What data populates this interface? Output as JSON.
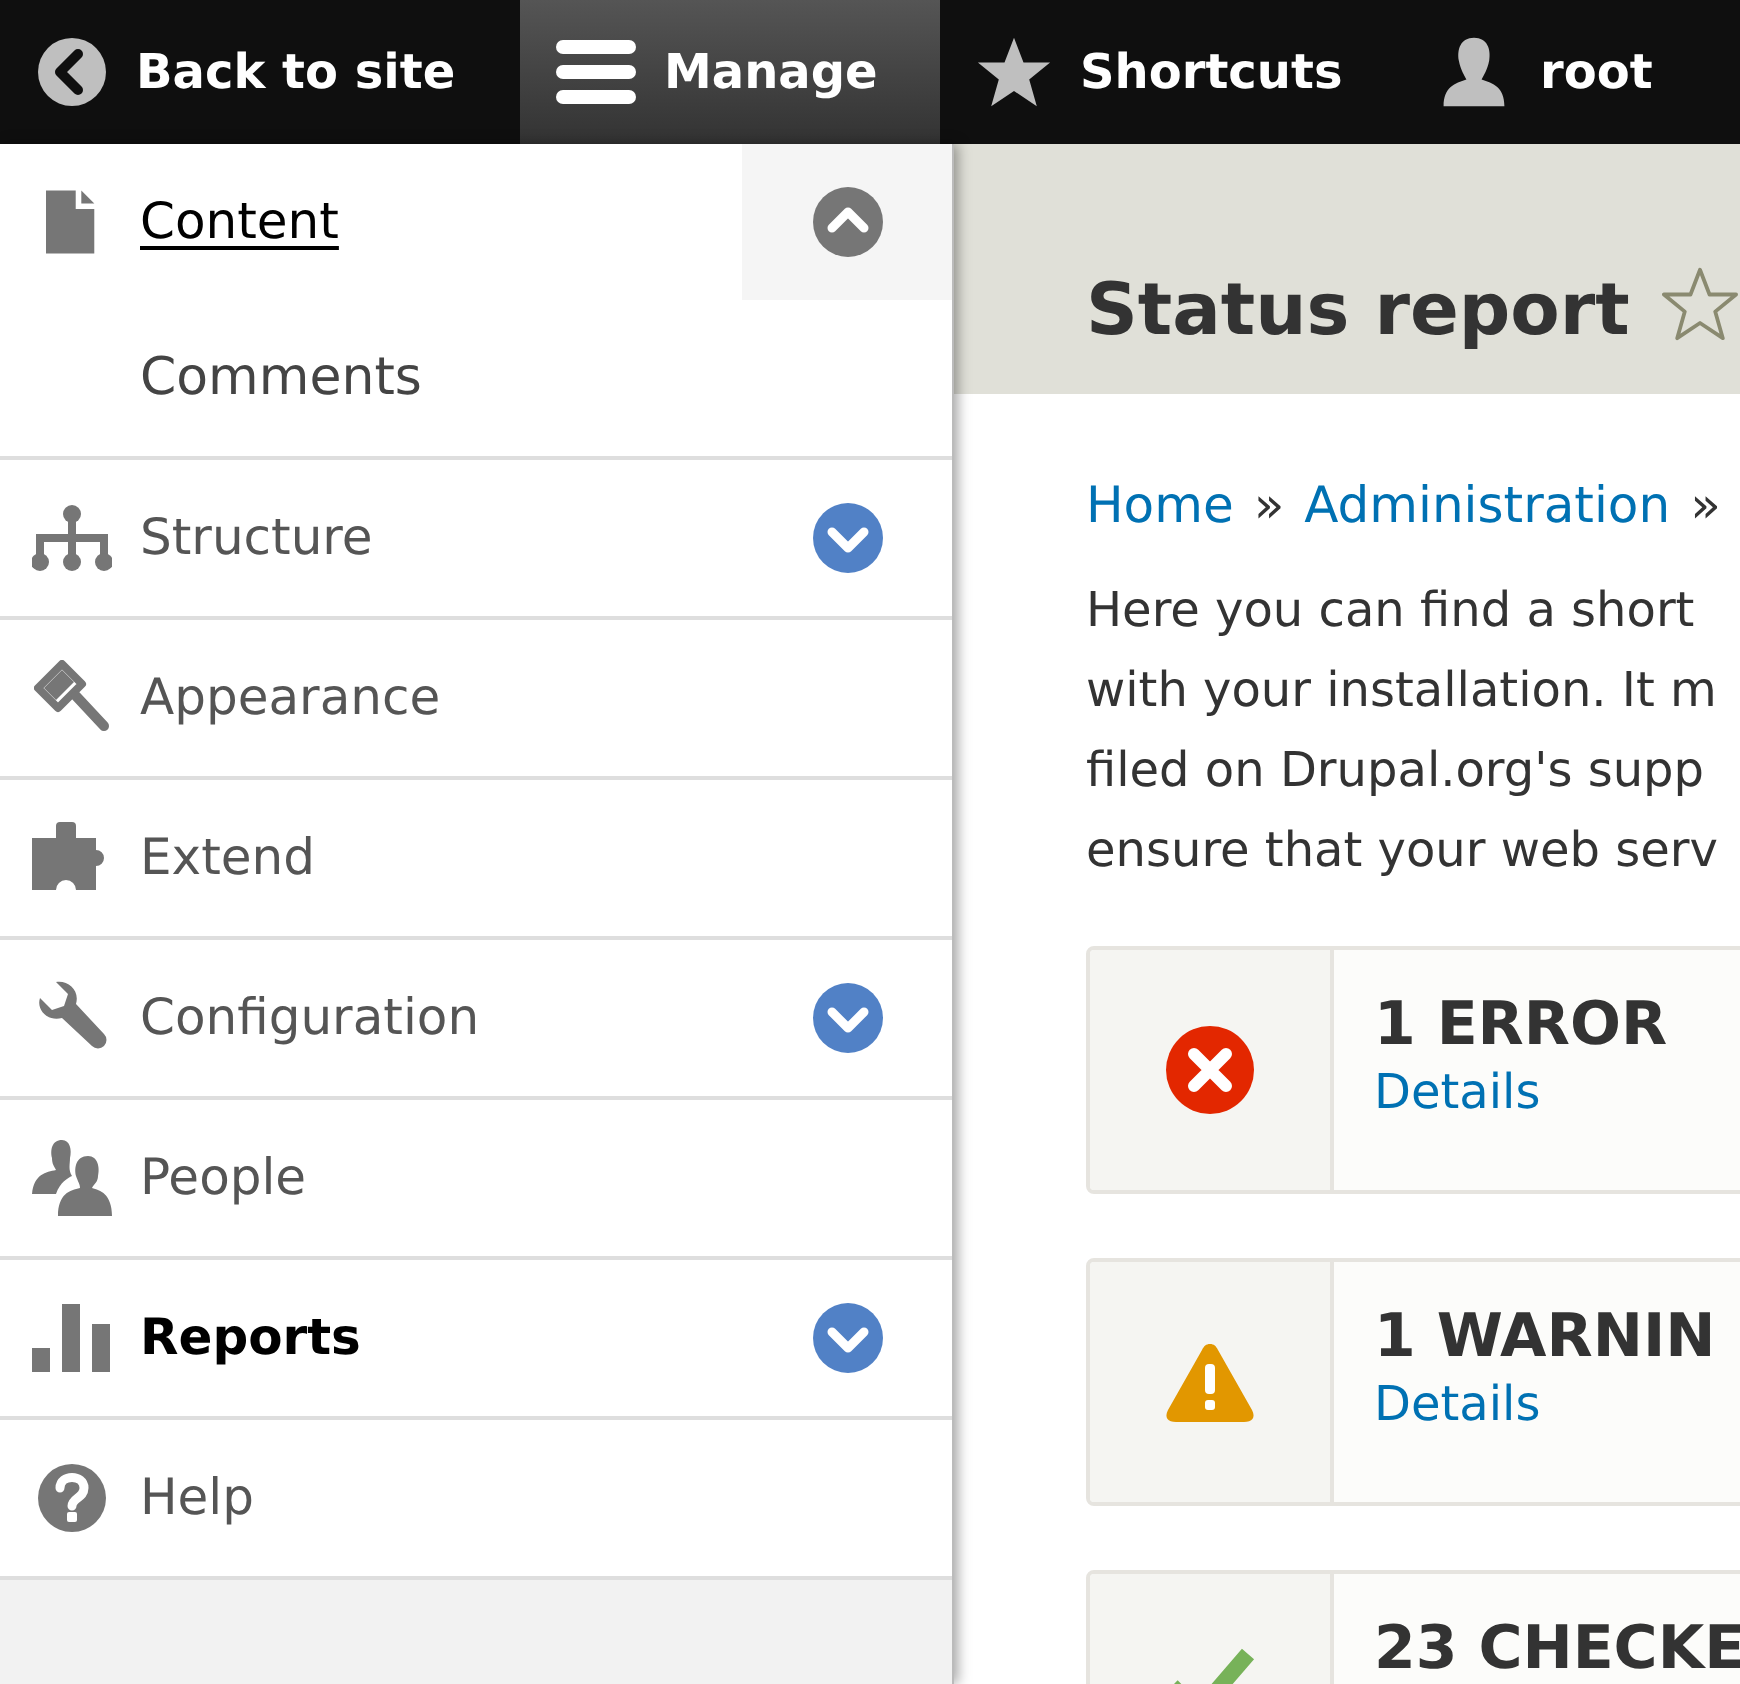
{
  "toolbar": [
    {
      "label": "Back to site",
      "selected": false
    },
    {
      "label": "Manage",
      "selected": true
    },
    {
      "label": "Shortcuts",
      "selected": false
    },
    {
      "label": "root",
      "selected": false
    }
  ],
  "sidebar": {
    "items": [
      {
        "label": "Content",
        "hovered": true,
        "selected": false,
        "expanded": true,
        "children": [
          {
            "label": "Comments",
            "hovered": false,
            "selected": false
          }
        ]
      },
      {
        "label": "Structure",
        "hovered": false,
        "selected": false,
        "expanded": false
      },
      {
        "label": "Appearance",
        "hovered": false,
        "selected": false
      },
      {
        "label": "Extend",
        "hovered": false,
        "selected": false
      },
      {
        "label": "Configuration",
        "hovered": false,
        "selected": false,
        "expanded": false
      },
      {
        "label": "People",
        "hovered": false,
        "selected": false
      },
      {
        "label": "Reports",
        "hovered": false,
        "selected": true,
        "expanded": false
      },
      {
        "label": "Help",
        "hovered": false,
        "selected": false
      }
    ]
  },
  "page": {
    "title": "Status report",
    "breadcrumb": [
      {
        "kind": "link",
        "label": "Home"
      },
      {
        "kind": "separator",
        "label": "»"
      },
      {
        "kind": "link",
        "label": "Administration"
      },
      {
        "kind": "separator",
        "label": "»"
      }
    ],
    "description_lines": [
      "Here you can find a short",
      "with your installation. It m",
      "filed on Drupal.org's supp",
      "ensure that your web serv"
    ],
    "status_cards": [
      {
        "kind": "error",
        "title": "1 ERROR",
        "link": "Details"
      },
      {
        "kind": "warning",
        "title": "1 WARNIN",
        "link": "Details"
      },
      {
        "kind": "checked",
        "title": "23 CHECKE"
      }
    ]
  }
}
